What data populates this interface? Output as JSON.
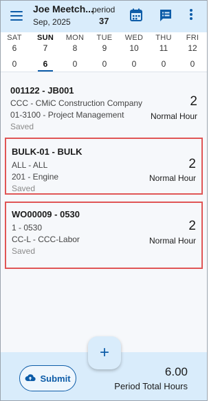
{
  "header": {
    "employee_name": "Joe Meetch...",
    "month": "Sep, 2025",
    "period_label": "period",
    "period_number": "37",
    "icons": [
      "menu-icon",
      "calendar-icon",
      "timesheet-icon",
      "more-vert-icon"
    ]
  },
  "week": [
    {
      "name": "SAT",
      "date": "6",
      "hours": "0"
    },
    {
      "name": "SUN",
      "date": "7",
      "hours": "6",
      "active": true
    },
    {
      "name": "MON",
      "date": "8",
      "hours": "0"
    },
    {
      "name": "TUE",
      "date": "9",
      "hours": "0"
    },
    {
      "name": "WED",
      "date": "10",
      "hours": "0"
    },
    {
      "name": "THU",
      "date": "11",
      "hours": "0"
    },
    {
      "name": "FRI",
      "date": "12",
      "hours": "0"
    }
  ],
  "entries": [
    {
      "title": "001122 - JB001",
      "line1": "CCC - CMiC Construction Company",
      "line2": "01-3100 - Project Management",
      "status": "Saved",
      "hours": "2",
      "hour_type": "Normal Hour"
    },
    {
      "title": "BULK-01 - BULK",
      "line1": "ALL - ALL",
      "line2": "201 - Engine",
      "status": "Saved",
      "hours": "2",
      "hour_type": "Normal Hour"
    },
    {
      "title": "WO00009 - 0530",
      "line1": "1 - 0530",
      "line2": "CC-L - CCC-Labor",
      "status": "Saved",
      "hours": "2",
      "hour_type": "Normal Hour"
    }
  ],
  "fab": {
    "label": "+"
  },
  "footer": {
    "submit_label": "Submit",
    "total_hours": "6.00",
    "total_label": "Period Total Hours"
  },
  "colors": {
    "accent": "#0d5ca8",
    "header_bg": "#d9ecfb",
    "highlight_border": "#e05555"
  }
}
